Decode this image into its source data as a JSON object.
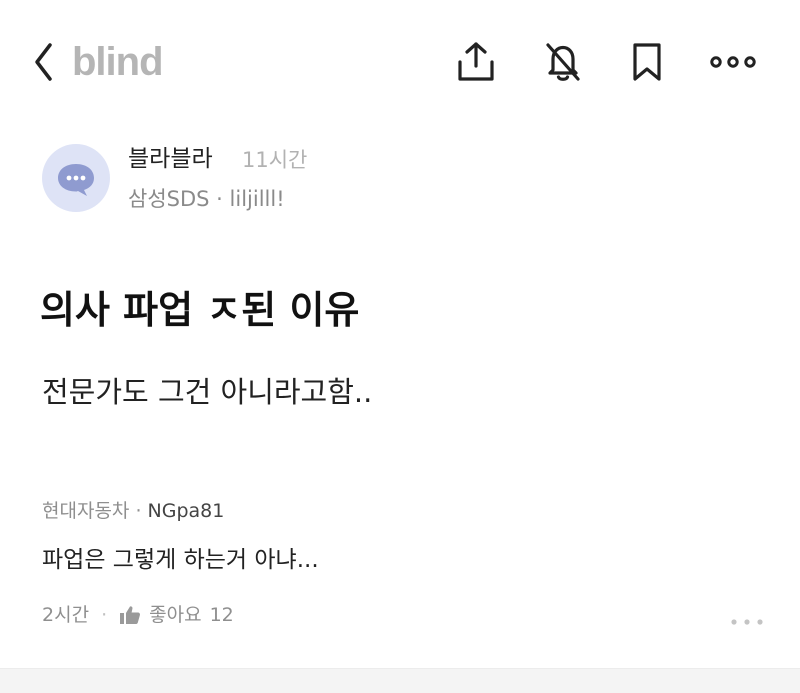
{
  "header": {
    "logo": "blind",
    "icons": [
      "back-icon",
      "share-icon",
      "notifications-off-icon",
      "bookmark-icon",
      "more-icon"
    ]
  },
  "author": {
    "name": "블라블라",
    "time": "11시간",
    "company": "삼성SDS",
    "separator": "·",
    "nickname": "liljilll!"
  },
  "post": {
    "title": "의사 파업 ㅈ된 이유",
    "body": "전문가도 그건 아니라고함.."
  },
  "comment": {
    "company": "현대자동차",
    "separator": "·",
    "nickname": "NGpa81",
    "text": "파업은 그렇게 하는거 아냐...",
    "time": "2시간",
    "dot": "·",
    "like_label": "좋아요",
    "like_count": "12"
  },
  "colors": {
    "logo": "#b5b5b5",
    "avatar_bg": "#dee3f6",
    "avatar_icon": "#8f9bd0",
    "muted_text": "#8f8f8f"
  }
}
